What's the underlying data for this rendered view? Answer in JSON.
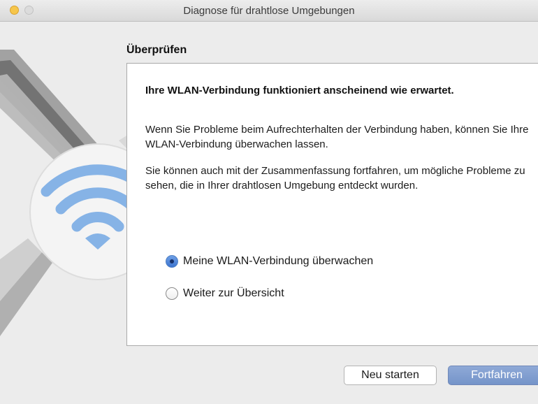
{
  "window": {
    "title": "Diagnose für drahtlose Umgebungen"
  },
  "section": {
    "title": "Überprüfen"
  },
  "panel": {
    "headline": "Ihre WLAN-Verbindung funktioniert anscheinend wie erwartet.",
    "paragraph1": "Wenn Sie Probleme beim Aufrechterhalten der Verbindung haben, können Sie Ihre WLAN-Verbindung überwachen lassen.",
    "paragraph2": "Sie können auch mit der Zusammenfassung fortfahren, um mögliche Probleme zu sehen, die in Ihrer drahtlosen Umgebung entdeckt wurden."
  },
  "options": [
    {
      "label": "Meine WLAN-Verbindung überwachen",
      "selected": true
    },
    {
      "label": "Weiter zur Übersicht",
      "selected": false
    }
  ],
  "buttons": {
    "restart": "Neu starten",
    "continue": "Fortfahren"
  },
  "icons": {
    "illustration": "wifi-diagnostics-icon",
    "wifi": "wifi-icon",
    "minimize": "minimize-window-icon",
    "zoom": "zoom-window-icon"
  },
  "colors": {
    "accent": "#4f86d9",
    "primary_button": "#7f9dd0",
    "wifi_waves": "#86b3e6"
  }
}
